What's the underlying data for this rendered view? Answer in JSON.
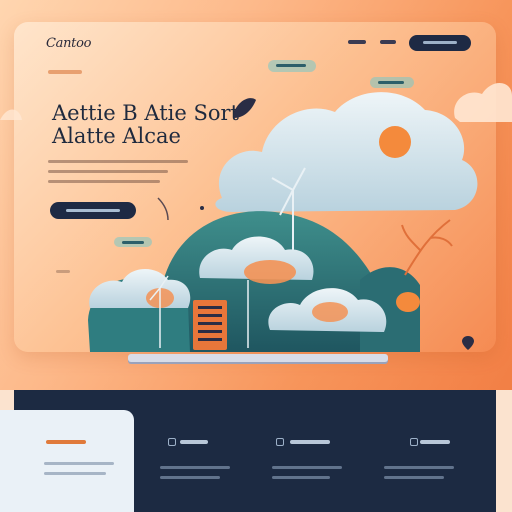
{
  "header": {
    "logo_text": "Cantoo"
  },
  "hero": {
    "title_line1": "Aettie B Atie Sort",
    "title_line2": "Alatte Alcae"
  },
  "colors": {
    "accent_orange": "#f27f45",
    "navy": "#1e2a44",
    "footer_bg": "#1c2a42",
    "teal": "#2f7d80",
    "cloud": "#dbe8ef"
  },
  "icons": [
    "leaf-icon",
    "feather-icon",
    "location-pin-icon",
    "wind-turbine-icon",
    "sun-icon",
    "cloud-icon"
  ]
}
